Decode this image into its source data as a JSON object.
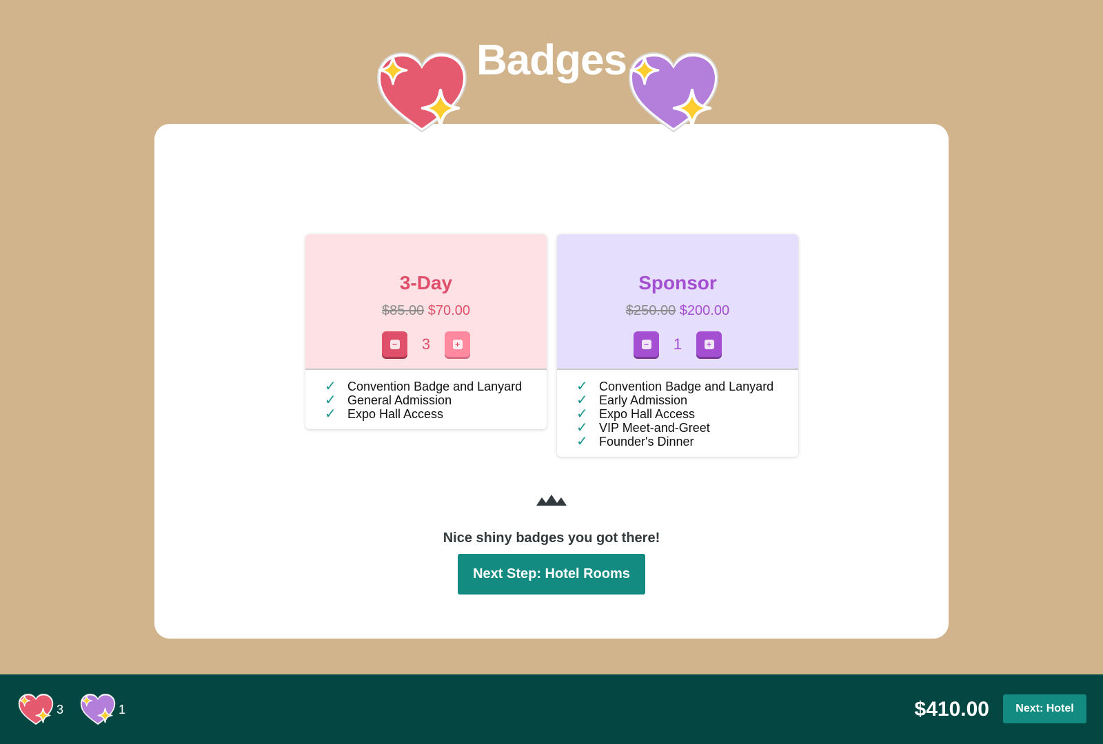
{
  "page": {
    "title": "Badges"
  },
  "badges": [
    {
      "name": "3-Day",
      "old_price": "$85.00",
      "new_price": "$70.00",
      "quantity": "3",
      "minus_icon": "minus-icon",
      "plus_icon": "plus-icon",
      "features": [
        "Convention Badge and Lanyard",
        "General Admission",
        "Expo Hall Access"
      ],
      "accent_color": "#e04f6a",
      "background_color": "#fde1e5",
      "icon": "sparkle-heart-icon"
    },
    {
      "name": "Sponsor",
      "old_price": "$250.00",
      "new_price": "$200.00",
      "quantity": "1",
      "minus_icon": "minus-icon",
      "plus_icon": "plus-icon",
      "features": [
        "Convention Badge and Lanyard",
        "Early Admission",
        "Expo Hall Access",
        "VIP Meet-and-Greet",
        "Founder's Dinner"
      ],
      "accent_color": "#a44fd1",
      "background_color": "#e6defd",
      "icon": "sparkle-heart-icon"
    }
  ],
  "feature_check_icon": "check-icon",
  "separator_icon": "mountains-icon",
  "tagline": "Nice shiny badges you got there!",
  "next_step_button": "Next Step: Hotel Rooms",
  "footer": {
    "cart": [
      {
        "icon": "pink-sparkle-heart-icon",
        "count": "3"
      },
      {
        "icon": "purple-sparkle-heart-icon",
        "count": "1"
      }
    ],
    "total": "$410.00",
    "next_button": "Next: Hotel",
    "background_color": "#044742",
    "button_color": "#138b80"
  },
  "page_background_color": "#d2b48c"
}
